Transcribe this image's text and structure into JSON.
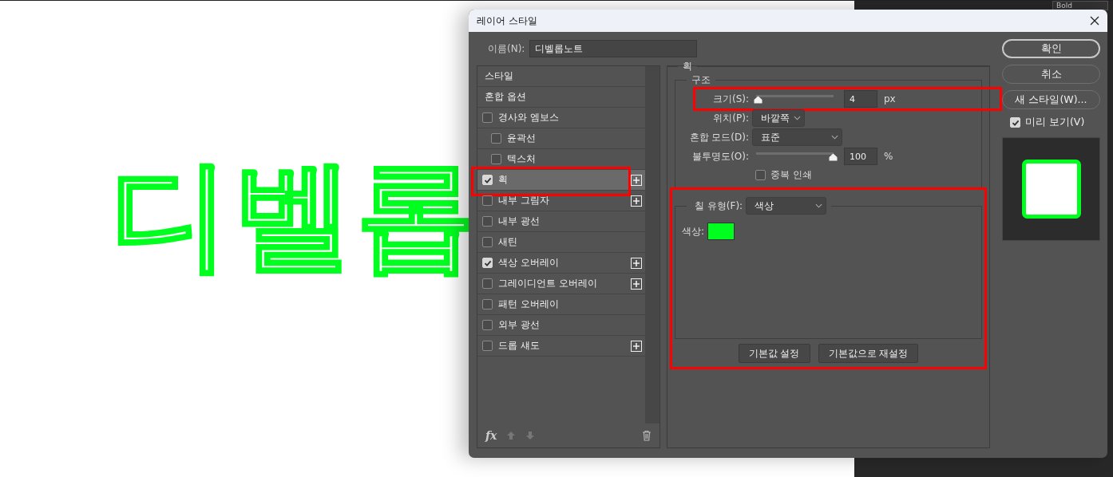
{
  "canvas": {
    "text": "디벨롭"
  },
  "background_panel": {
    "text": "Bold"
  },
  "dialog": {
    "title": "레이어 스타일"
  },
  "name_field": {
    "label": "이름(N):",
    "value": "디벨롭노트"
  },
  "styles": [
    {
      "label": "스타일",
      "kind": "header",
      "selected": false
    },
    {
      "label": "혼합 옵션",
      "kind": "header",
      "selected": false
    },
    {
      "label": "경사와 엠보스",
      "kind": "check",
      "checked": false,
      "selected": false,
      "children": [
        {
          "label": "윤곽선",
          "kind": "check",
          "checked": false,
          "selected": false
        },
        {
          "label": "텍스처",
          "kind": "check",
          "checked": false,
          "selected": false
        }
      ]
    },
    {
      "label": "획",
      "kind": "check",
      "checked": true,
      "selected": true,
      "plus": true,
      "highlighted": true
    },
    {
      "label": "내부 그림자",
      "kind": "check",
      "checked": false,
      "selected": false,
      "plus": true
    },
    {
      "label": "내부 광선",
      "kind": "check",
      "checked": false,
      "selected": false
    },
    {
      "label": "새틴",
      "kind": "check",
      "checked": false,
      "selected": false
    },
    {
      "label": "색상 오버레이",
      "kind": "check",
      "checked": true,
      "selected": false,
      "plus": true
    },
    {
      "label": "그레이디언트 오버레이",
      "kind": "check",
      "checked": false,
      "selected": false,
      "plus": true
    },
    {
      "label": "패턴 오버레이",
      "kind": "check",
      "checked": false,
      "selected": false
    },
    {
      "label": "외부 광선",
      "kind": "check",
      "checked": false,
      "selected": false
    },
    {
      "label": "드롭 섀도",
      "kind": "check",
      "checked": false,
      "selected": false,
      "plus": true
    }
  ],
  "list_footer": {
    "fx": "fx"
  },
  "panel": {
    "title": "획",
    "structure": {
      "title": "구조",
      "size": {
        "label": "크기(S):",
        "level": 0.02,
        "value": "4",
        "unit": "px",
        "highlighted": true
      },
      "position": {
        "label": "위치(P):",
        "value": "바깥쪽"
      },
      "blend_mode": {
        "label": "혼합 모드(D):",
        "value": "표준"
      },
      "opacity": {
        "label": "불투명도(O):",
        "level": 1,
        "value": "100",
        "unit": "%"
      },
      "overprint": {
        "label": "중복 인쇄",
        "checked": false
      }
    },
    "fill": {
      "label": "칠 유형(F):",
      "value": "색상",
      "highlighted": true,
      "color_label": "색상:",
      "color": "#00ff1e",
      "buttons": [
        "기본값 설정",
        "기본값으로 재설정"
      ]
    }
  },
  "actions": [
    {
      "label": "확인",
      "default": true
    },
    {
      "label": "취소",
      "default": false
    },
    {
      "label": "새 스타일(W)...",
      "default": false
    }
  ],
  "preview": {
    "label": "미리 보기(V)",
    "checked": true
  }
}
